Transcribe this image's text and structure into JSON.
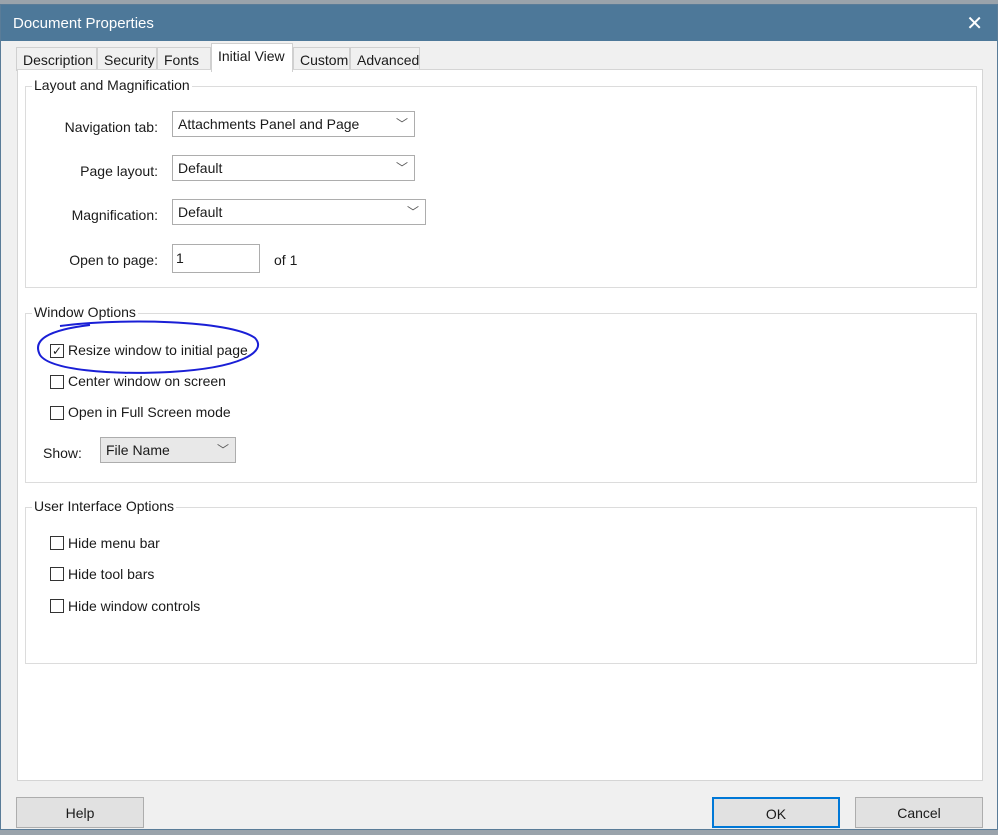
{
  "title": "Document Properties",
  "tabs": [
    "Description",
    "Security",
    "Fonts",
    "Initial View",
    "Custom",
    "Advanced"
  ],
  "active_tab": "Initial View",
  "layout": {
    "legend": "Layout and Magnification",
    "nav_label": "Navigation tab:",
    "nav_value": "Attachments Panel and Page",
    "page_layout_label": "Page layout:",
    "page_layout_value": "Default",
    "mag_label": "Magnification:",
    "mag_value": "Default",
    "open_label": "Open to page:",
    "open_value": "1",
    "of_text": "of 1"
  },
  "window": {
    "legend": "Window Options",
    "options": [
      {
        "label": "Resize window to initial page",
        "checked": true
      },
      {
        "label": "Center window on screen",
        "checked": false
      },
      {
        "label": "Open in Full Screen mode",
        "checked": false
      }
    ],
    "show_label": "Show:",
    "show_value": "File Name"
  },
  "ui": {
    "legend": "User Interface Options",
    "options": [
      {
        "label": "Hide menu bar",
        "checked": false
      },
      {
        "label": "Hide tool bars",
        "checked": false
      },
      {
        "label": "Hide window controls",
        "checked": false
      }
    ]
  },
  "buttons": {
    "help": "Help",
    "ok": "OK",
    "cancel": "Cancel"
  },
  "annotation_color": "#1a1fd6"
}
